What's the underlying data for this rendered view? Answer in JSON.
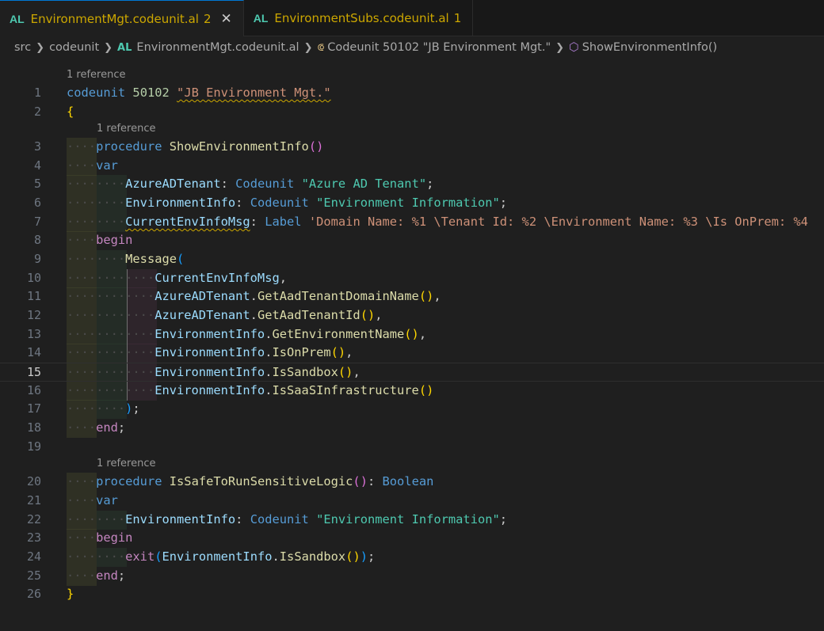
{
  "tabs": [
    {
      "lang": "AL",
      "name": "EnvironmentMgt.codeunit.al",
      "problems": "2",
      "close": "✕"
    },
    {
      "lang": "AL",
      "name": "EnvironmentSubs.codeunit.al",
      "problems": "1"
    }
  ],
  "breadcrumb": {
    "items": [
      "src",
      "codeunit",
      "EnvironmentMgt.codeunit.al",
      "Codeunit 50102 \"JB Environment Mgt.\"",
      "ShowEnvironmentInfo()"
    ],
    "file_lang": "AL"
  },
  "codelens": {
    "line1": "1 reference",
    "line3": "1 reference",
    "line20": "1 reference"
  },
  "line_numbers": [
    "1",
    "2",
    "3",
    "4",
    "5",
    "6",
    "7",
    "8",
    "9",
    "10",
    "11",
    "12",
    "13",
    "14",
    "15",
    "16",
    "17",
    "18",
    "19",
    "20",
    "21",
    "22",
    "23",
    "24",
    "25",
    "26"
  ],
  "current_line": "15",
  "code": {
    "l1": {
      "kw": "codeunit",
      "num": "50102",
      "name": "\"JB Environment Mgt.\""
    },
    "l2": "{",
    "l3": {
      "kw": "procedure",
      "fn": "ShowEnvironmentInfo",
      "parens": "()"
    },
    "l4": "var",
    "l5": {
      "var": "AzureADTenant",
      "colon": ": ",
      "type": "Codeunit",
      "str": "\"Azure AD Tenant\"",
      "end": ";"
    },
    "l6": {
      "var": "EnvironmentInfo",
      "colon": ": ",
      "type": "Codeunit",
      "str": "\"Environment Information\"",
      "end": ";"
    },
    "l7": {
      "var": "CurrentEnvInfoMsg",
      "colon": ": ",
      "type": "Label",
      "str": "'Domain Name: %1 \\Tenant Id: %2 \\Environment Name: %3 \\Is OnPrem: %4"
    },
    "l8": "begin",
    "l9": {
      "fn": "Message",
      "open": "("
    },
    "l10": {
      "var": "CurrentEnvInfoMsg",
      "end": ","
    },
    "l11": {
      "obj": "AzureADTenant",
      "dot": ".",
      "fn": "GetAadTenantDomainName",
      "parens": "()",
      "end": ","
    },
    "l12": {
      "obj": "AzureADTenant",
      "dot": ".",
      "fn": "GetAadTenantId",
      "parens": "()",
      "end": ","
    },
    "l13": {
      "obj": "EnvironmentInfo",
      "dot": ".",
      "fn": "GetEnvironmentName",
      "parens": "()",
      "end": ","
    },
    "l14": {
      "obj": "EnvironmentInfo",
      "dot": ".",
      "fn": "IsOnPrem",
      "parens": "()",
      "end": ","
    },
    "l15": {
      "obj": "EnvironmentInfo",
      "dot": ".",
      "fn": "IsSandbox",
      "parens": "()",
      "end": ","
    },
    "l16": {
      "obj": "EnvironmentInfo",
      "dot": ".",
      "fn": "IsSaaSInfrastructure",
      "parens": "()"
    },
    "l17": {
      "close": ")",
      "end": ";"
    },
    "l18": {
      "kw": "end",
      "end": ";"
    },
    "l20": {
      "kw": "procedure",
      "fn": "IsSafeToRunSensitiveLogic",
      "parens": "()",
      "colon": ": ",
      "type": "Boolean"
    },
    "l21": "var",
    "l22": {
      "var": "EnvironmentInfo",
      "colon": ": ",
      "type": "Codeunit",
      "str": "\"Environment Information\"",
      "end": ";"
    },
    "l23": "begin",
    "l24": {
      "kw": "exit",
      "open": "(",
      "obj": "EnvironmentInfo",
      "dot": ".",
      "fn": "IsSandbox",
      "parens": "()",
      "close": ")",
      "end": ";"
    },
    "l25": {
      "kw": "end",
      "end": ";"
    },
    "l26": "}"
  }
}
